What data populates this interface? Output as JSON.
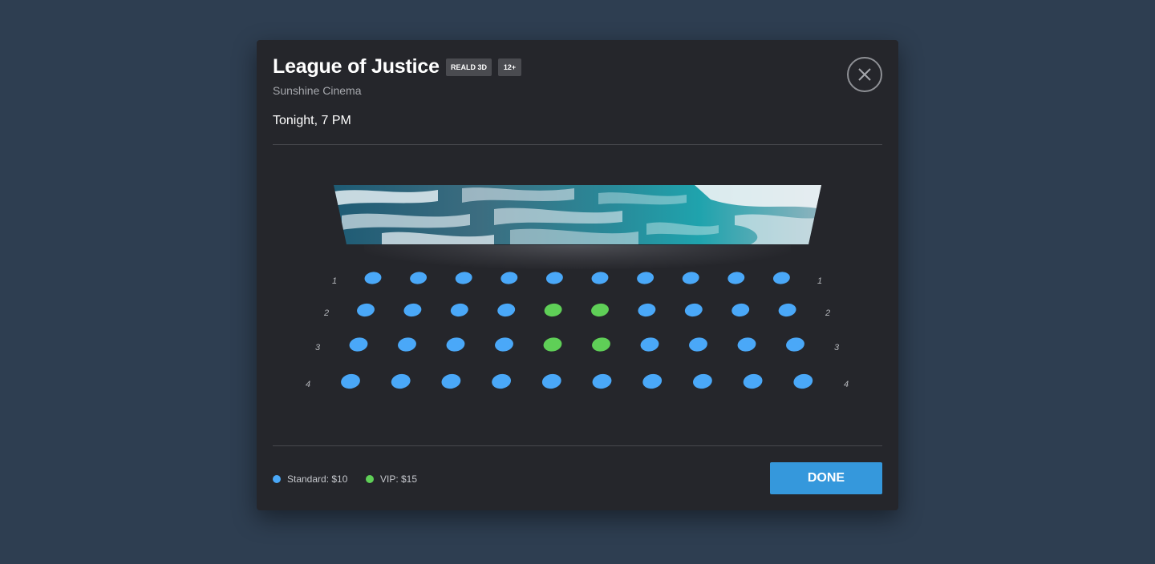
{
  "movie": {
    "title": "League of Justice",
    "badges": [
      "REALD 3D",
      "12+"
    ],
    "venue": "Sunshine Cinema",
    "showtime": "Tonight, 7 PM"
  },
  "close_icon": "close-icon",
  "screen": {
    "image": "ocean-waves-aerial"
  },
  "seating": {
    "rows": [
      {
        "label": "1",
        "seats": [
          "standard",
          "standard",
          "standard",
          "standard",
          "standard",
          "standard",
          "standard",
          "standard",
          "standard",
          "standard"
        ]
      },
      {
        "label": "2",
        "seats": [
          "standard",
          "standard",
          "standard",
          "standard",
          "vip",
          "vip",
          "standard",
          "standard",
          "standard",
          "standard"
        ]
      },
      {
        "label": "3",
        "seats": [
          "standard",
          "standard",
          "standard",
          "standard",
          "vip",
          "vip",
          "standard",
          "standard",
          "standard",
          "standard"
        ]
      },
      {
        "label": "4",
        "seats": [
          "standard",
          "standard",
          "standard",
          "standard",
          "standard",
          "standard",
          "standard",
          "standard",
          "standard",
          "standard"
        ]
      }
    ]
  },
  "legend": {
    "standard": {
      "label": "Standard: $10",
      "color": "#4aa8f8"
    },
    "vip": {
      "label": "VIP: $15",
      "color": "#5fcf57"
    }
  },
  "done_label": "DONE",
  "colors": {
    "accent": "#3598dc",
    "background": "#2e3e51",
    "modal": "#25262b"
  }
}
